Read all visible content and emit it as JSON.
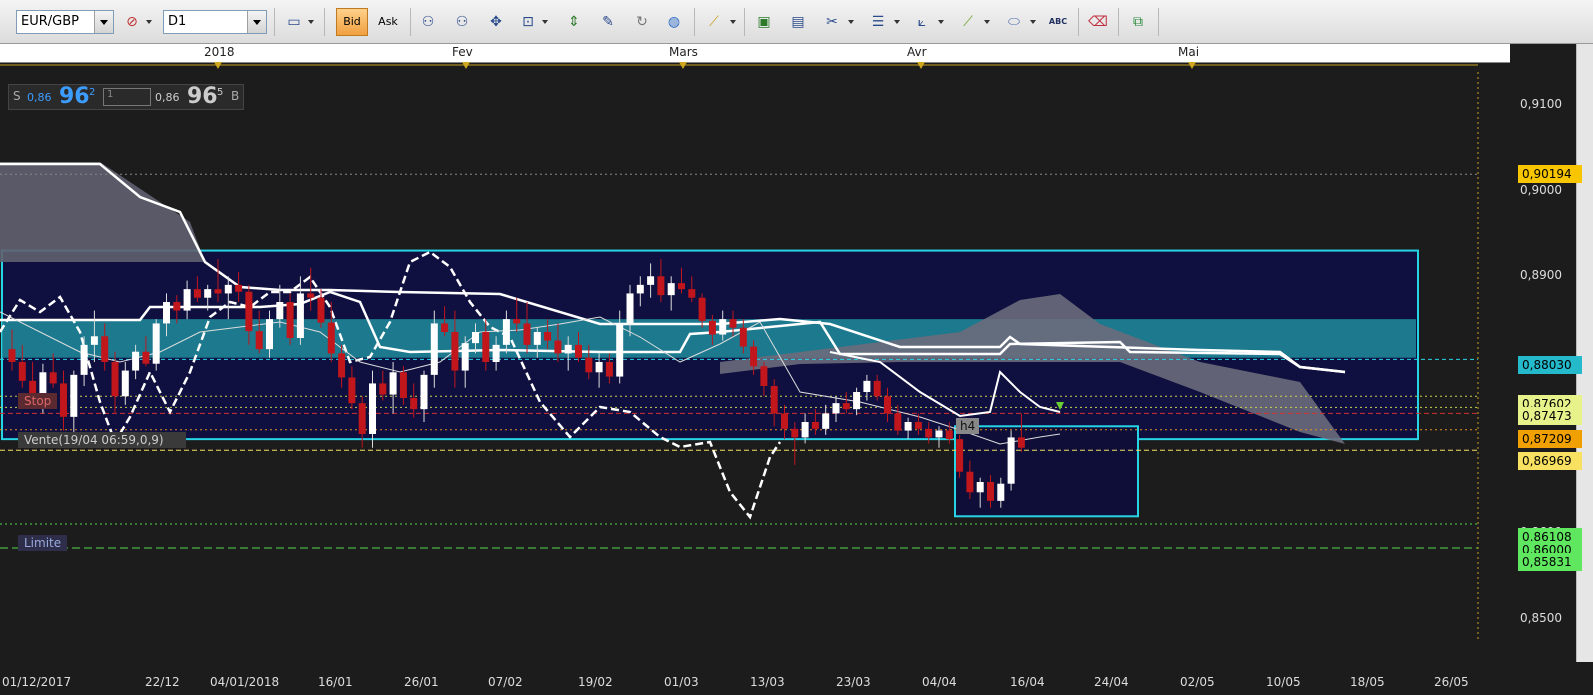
{
  "toolbar": {
    "symbol": "EUR/GBP",
    "timeframe": "D1",
    "bid_label": "Bid",
    "ask_label": "Ask",
    "abc_label": "ABC"
  },
  "months": [
    {
      "label": "2018",
      "x": 218
    },
    {
      "label": "Fev",
      "x": 466
    },
    {
      "label": "Mars",
      "x": 683
    },
    {
      "label": "Avr",
      "x": 921
    },
    {
      "label": "Mai",
      "x": 1192
    }
  ],
  "quote": {
    "sell_letter": "S",
    "sell_prefix": "0,86",
    "sell_big": "96",
    "sell_sup": "2",
    "qty": "1",
    "buy_prefix": "0,86",
    "buy_big": "96",
    "buy_sup": "5",
    "buy_letter": "B"
  },
  "order_tags": {
    "stop": "Stop",
    "sell_order": "Vente(19/04 06:59,0,9)",
    "limit": "Limite",
    "h4": "h4"
  },
  "price_axis": {
    "labels": [
      "0,9100",
      "0,9000",
      "0,8900",
      "0,8800",
      "0,8600",
      "0,8500"
    ],
    "tags": [
      {
        "text": "0,90194",
        "color": "#f7c600"
      },
      {
        "text": "0,88030",
        "color": "#25b9cc"
      },
      {
        "text": "0,87602",
        "color": "#e8f28a"
      },
      {
        "text": "0,87473",
        "color": "#e8f28a"
      },
      {
        "text": "0,87209",
        "color": "#f0a000"
      },
      {
        "text": "0,86969",
        "color": "#f8e060"
      },
      {
        "text": "0,86108",
        "color": "#5fe85f"
      },
      {
        "text": "0,86000",
        "color": "#5fe85f"
      },
      {
        "text": "0,85831",
        "color": "#5fe85f"
      }
    ]
  },
  "date_labels": [
    "01/12/2017",
    "22/12",
    "04/01/2018",
    "16/01",
    "26/01",
    "07/02",
    "19/02",
    "01/03",
    "13/03",
    "23/03",
    "04/04",
    "16/04",
    "24/04",
    "02/05",
    "10/05",
    "18/05",
    "26/05"
  ],
  "colors": {
    "up_candle": "#ffffff",
    "down_candle": "#c0161c",
    "box_border": "#27d4e6",
    "cloud": "#6c6c78",
    "band": "#2aa4b4"
  },
  "chart_data": {
    "type": "candlestick",
    "ylim": [
      0.845,
      0.915
    ],
    "candles": [
      [
        0.8815,
        0.8838,
        0.879,
        0.88
      ],
      [
        0.88,
        0.882,
        0.877,
        0.8778
      ],
      [
        0.8778,
        0.88,
        0.8745,
        0.876
      ],
      [
        0.876,
        0.8798,
        0.874,
        0.8788
      ],
      [
        0.8788,
        0.881,
        0.877,
        0.8775
      ],
      [
        0.8775,
        0.879,
        0.872,
        0.8736
      ],
      [
        0.8736,
        0.879,
        0.87,
        0.8785
      ],
      [
        0.8785,
        0.883,
        0.8772,
        0.882
      ],
      [
        0.882,
        0.886,
        0.88,
        0.883
      ],
      [
        0.883,
        0.8845,
        0.879,
        0.88
      ],
      [
        0.88,
        0.8812,
        0.874,
        0.876
      ],
      [
        0.876,
        0.88,
        0.875,
        0.879
      ],
      [
        0.879,
        0.882,
        0.878,
        0.8812
      ],
      [
        0.8812,
        0.883,
        0.8795,
        0.8798
      ],
      [
        0.8798,
        0.885,
        0.879,
        0.8845
      ],
      [
        0.8845,
        0.888,
        0.883,
        0.887
      ],
      [
        0.887,
        0.8878,
        0.8845,
        0.886
      ],
      [
        0.886,
        0.8895,
        0.885,
        0.8885
      ],
      [
        0.8885,
        0.89,
        0.887,
        0.8875
      ],
      [
        0.8875,
        0.889,
        0.886,
        0.8885
      ],
      [
        0.8885,
        0.892,
        0.887,
        0.888
      ],
      [
        0.888,
        0.89,
        0.885,
        0.889
      ],
      [
        0.889,
        0.8905,
        0.887,
        0.8882
      ],
      [
        0.8882,
        0.889,
        0.882,
        0.8836
      ],
      [
        0.8836,
        0.886,
        0.881,
        0.8815
      ],
      [
        0.8815,
        0.886,
        0.8805,
        0.885
      ],
      [
        0.885,
        0.889,
        0.884,
        0.887
      ],
      [
        0.887,
        0.888,
        0.882,
        0.8828
      ],
      [
        0.8828,
        0.89,
        0.882,
        0.888
      ],
      [
        0.888,
        0.891,
        0.886,
        0.8875
      ],
      [
        0.8875,
        0.8885,
        0.884,
        0.8846
      ],
      [
        0.8846,
        0.887,
        0.88,
        0.881
      ],
      [
        0.881,
        0.882,
        0.877,
        0.8782
      ],
      [
        0.8782,
        0.8795,
        0.8745,
        0.8752
      ],
      [
        0.8752,
        0.876,
        0.87,
        0.8716
      ],
      [
        0.8716,
        0.879,
        0.87,
        0.8775
      ],
      [
        0.8775,
        0.879,
        0.8755,
        0.8762
      ],
      [
        0.8762,
        0.88,
        0.874,
        0.8788
      ],
      [
        0.8788,
        0.8795,
        0.875,
        0.8758
      ],
      [
        0.8758,
        0.8775,
        0.8735,
        0.8745
      ],
      [
        0.8745,
        0.879,
        0.873,
        0.8785
      ],
      [
        0.8785,
        0.886,
        0.877,
        0.8845
      ],
      [
        0.8845,
        0.8865,
        0.883,
        0.8835
      ],
      [
        0.8835,
        0.886,
        0.877,
        0.879
      ],
      [
        0.879,
        0.883,
        0.877,
        0.8822
      ],
      [
        0.8822,
        0.8845,
        0.881,
        0.8835
      ],
      [
        0.8835,
        0.885,
        0.879,
        0.88
      ],
      [
        0.88,
        0.883,
        0.879,
        0.882
      ],
      [
        0.882,
        0.886,
        0.881,
        0.885
      ],
      [
        0.885,
        0.8875,
        0.8835,
        0.8845
      ],
      [
        0.8845,
        0.887,
        0.881,
        0.882
      ],
      [
        0.882,
        0.884,
        0.8805,
        0.8835
      ],
      [
        0.8835,
        0.885,
        0.8815,
        0.8825
      ],
      [
        0.8825,
        0.8845,
        0.88,
        0.881
      ],
      [
        0.881,
        0.883,
        0.879,
        0.882
      ],
      [
        0.882,
        0.8835,
        0.88,
        0.8805
      ],
      [
        0.8805,
        0.882,
        0.878,
        0.8788
      ],
      [
        0.8788,
        0.881,
        0.877,
        0.88
      ],
      [
        0.88,
        0.881,
        0.8775,
        0.8783
      ],
      [
        0.8783,
        0.886,
        0.8775,
        0.8845
      ],
      [
        0.8845,
        0.889,
        0.883,
        0.888
      ],
      [
        0.888,
        0.89,
        0.8865,
        0.889
      ],
      [
        0.889,
        0.8915,
        0.8875,
        0.89
      ],
      [
        0.89,
        0.892,
        0.887,
        0.8878
      ],
      [
        0.8878,
        0.89,
        0.886,
        0.8892
      ],
      [
        0.8892,
        0.891,
        0.888,
        0.8885
      ],
      [
        0.8885,
        0.89,
        0.887,
        0.8875
      ],
      [
        0.8875,
        0.888,
        0.884,
        0.8848
      ],
      [
        0.8848,
        0.8855,
        0.882,
        0.8832
      ],
      [
        0.8832,
        0.886,
        0.8825,
        0.885
      ],
      [
        0.885,
        0.886,
        0.883,
        0.884
      ],
      [
        0.884,
        0.885,
        0.881,
        0.8818
      ],
      [
        0.8818,
        0.8825,
        0.8785,
        0.8795
      ],
      [
        0.8795,
        0.88,
        0.876,
        0.8772
      ],
      [
        0.8772,
        0.878,
        0.8725,
        0.874
      ],
      [
        0.874,
        0.875,
        0.871,
        0.8722
      ],
      [
        0.8722,
        0.873,
        0.868,
        0.8712
      ],
      [
        0.8712,
        0.874,
        0.8705,
        0.873
      ],
      [
        0.873,
        0.8745,
        0.8715,
        0.8722
      ],
      [
        0.8722,
        0.875,
        0.8715,
        0.874
      ],
      [
        0.874,
        0.876,
        0.873,
        0.8752
      ],
      [
        0.8752,
        0.8765,
        0.874,
        0.8745
      ],
      [
        0.8745,
        0.877,
        0.8738,
        0.8765
      ],
      [
        0.8765,
        0.8785,
        0.8755,
        0.8778
      ],
      [
        0.8778,
        0.8785,
        0.8755,
        0.876
      ],
      [
        0.876,
        0.877,
        0.873,
        0.874
      ],
      [
        0.874,
        0.875,
        0.8715,
        0.872
      ],
      [
        0.872,
        0.8735,
        0.871,
        0.873
      ],
      [
        0.873,
        0.874,
        0.8715,
        0.8722
      ],
      [
        0.8722,
        0.873,
        0.8705,
        0.8712
      ],
      [
        0.8712,
        0.8725,
        0.87,
        0.872
      ],
      [
        0.872,
        0.873,
        0.8705,
        0.871
      ],
      [
        0.871,
        0.8715,
        0.8665,
        0.8672
      ],
      [
        0.8672,
        0.8685,
        0.864,
        0.8648
      ],
      [
        0.8648,
        0.8665,
        0.863,
        0.866
      ],
      [
        0.866,
        0.8668,
        0.863,
        0.8638
      ],
      [
        0.8638,
        0.8665,
        0.863,
        0.8658
      ],
      [
        0.8658,
        0.872,
        0.865,
        0.8712
      ],
      [
        0.8712,
        0.874,
        0.8695,
        0.87
      ]
    ]
  }
}
